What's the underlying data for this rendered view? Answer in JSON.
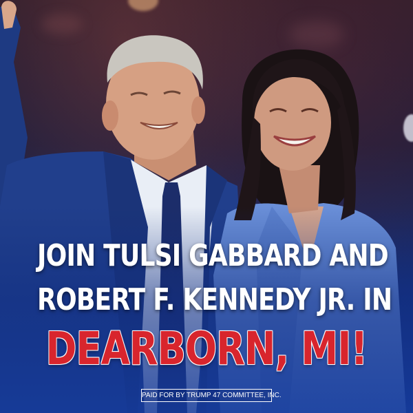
{
  "headline": {
    "line1": "JOIN TULSI GABBARD AND",
    "line2": "ROBERT F. KENNEDY JR. IN",
    "line3": "DEARBORN, MI!"
  },
  "disclaimer": "PAID FOR BY TRUMP 47 COMMITTEE, INC.",
  "colors": {
    "headline_text": "#ffffff",
    "location_text": "#d8252d",
    "background_bottom": "#1a3a93"
  }
}
